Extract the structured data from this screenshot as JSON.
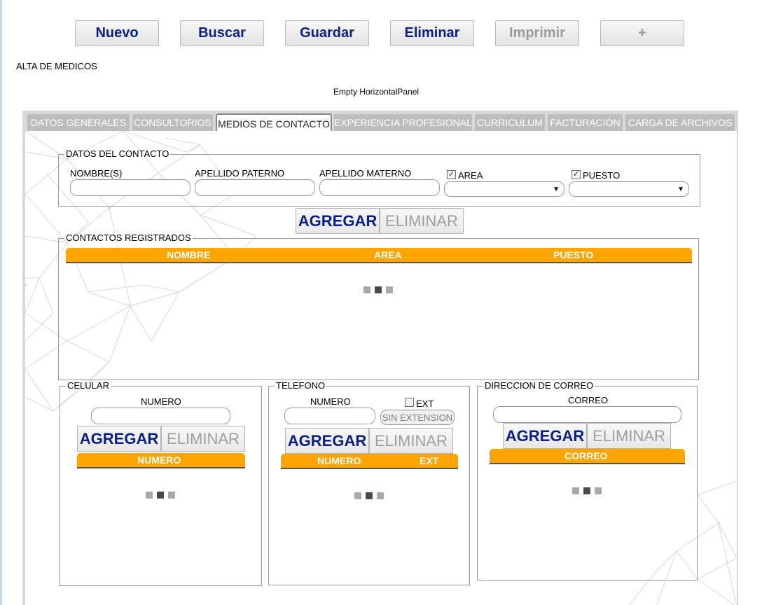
{
  "toolbar": {
    "nuevo": "Nuevo",
    "buscar": "Buscar",
    "guardar": "Guardar",
    "eliminar": "Eliminar",
    "imprimir": "Imprimir",
    "plus": "+"
  },
  "page": {
    "title": "ALTA DE MEDICOS",
    "empty_panel": "Empty HorizontalPanel"
  },
  "tabs": [
    {
      "label": "DATOS GENERALES"
    },
    {
      "label": "CONSULTORIOS"
    },
    {
      "label": "MEDIOS DE CONTACTO"
    },
    {
      "label": "EXPERIENCIA PROFESIONAL"
    },
    {
      "label": "CURRICULUM"
    },
    {
      "label": "FACTURACIÓN"
    },
    {
      "label": "CARGA DE ARCHIVOS"
    }
  ],
  "contacto": {
    "legend": "DATOS DEL CONTACTO",
    "nombre_label": "NOMBRE(S)",
    "nombre_value": "",
    "paterno_label": "APELLIDO PATERNO",
    "paterno_value": "",
    "materno_label": "APELLIDO MATERNO",
    "materno_value": "",
    "area_label": "AREA",
    "area_checked": true,
    "area_selected": "",
    "puesto_label": "PUESTO",
    "puesto_checked": true,
    "puesto_selected": "",
    "agregar": "AGREGAR",
    "eliminar": "ELIMINAR"
  },
  "registrados": {
    "legend": "CONTACTOS REGISTRADOS",
    "columns": [
      "NOMBRE",
      "AREA",
      "PUESTO"
    ]
  },
  "celular": {
    "legend": "CELULAR",
    "numero_label": "NUMERO",
    "numero_value": "",
    "agregar": "AGREGAR",
    "eliminar": "ELIMINAR",
    "columns": [
      "NUMERO"
    ]
  },
  "telefono": {
    "legend": "TELEFONO",
    "numero_label": "NUMERO",
    "numero_value": "",
    "ext_label": "EXT",
    "ext_checked": false,
    "sin_extension": "SIN EXTENSION",
    "agregar": "AGREGAR",
    "eliminar": "ELIMINAR",
    "columns": [
      "NUMERO",
      "EXT"
    ]
  },
  "correo": {
    "legend": "DIRECCION DE CORREO",
    "correo_label": "CORREO",
    "correo_value": "",
    "agregar": "AGREGAR",
    "eliminar": "ELIMINAR",
    "columns": [
      "CORREO"
    ]
  },
  "colors": {
    "grid_header": "#ffa500",
    "button_text": "#0b1f8a",
    "disabled_text": "#9b9b9b",
    "tab_inactive": "#bdbdbd",
    "loader_light": "#a8a8a8",
    "loader_dark": "#4a4a4a"
  }
}
